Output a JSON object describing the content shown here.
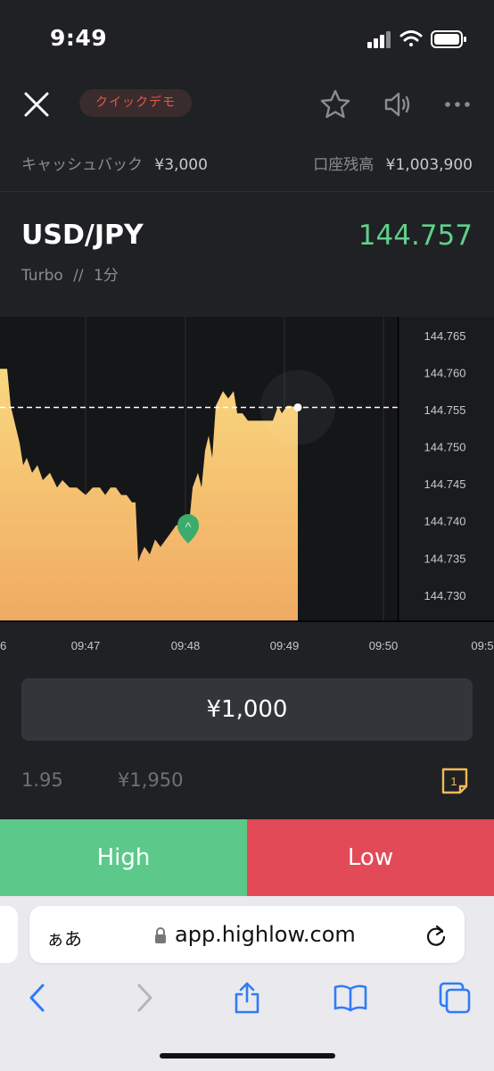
{
  "status_bar": {
    "time": "9:49"
  },
  "header": {
    "mode_badge": "クイックデモ",
    "cashback_label": "キャッシュバック",
    "cashback_value": "¥3,000",
    "balance_label": "口座残高",
    "balance_value": "¥1,003,900"
  },
  "instrument": {
    "pair": "USD/JPY",
    "price": "144.757",
    "type": "Turbo",
    "separator": "//",
    "duration": "1分"
  },
  "chart_data": {
    "type": "area",
    "y_ticks": [
      "144.765",
      "144.760",
      "144.755",
      "144.750",
      "144.745",
      "144.740",
      "144.735",
      "144.730"
    ],
    "x_ticks": [
      "6",
      "09:47",
      "09:48",
      "09:49",
      "09:50",
      "09:5"
    ],
    "current_level": 144.7553,
    "ylim": [
      144.7265,
      144.7675
    ],
    "series": [
      {
        "x": [
          0,
          8,
          12,
          22,
          26,
          30,
          36,
          42,
          48,
          56,
          64,
          70,
          78,
          86,
          96,
          104,
          112,
          118,
          124,
          130,
          136,
          142,
          148,
          152,
          155,
          158,
          162,
          168,
          174,
          180,
          186,
          192,
          198,
          204,
          208,
          212,
          216,
          222,
          226,
          230,
          234,
          238,
          242,
          246,
          250,
          256,
          262,
          266,
          272,
          278,
          284,
          290,
          296,
          302,
          306,
          312,
          316,
          322,
          326,
          332,
          334
        ],
        "y": [
          144.7605,
          144.7605,
          144.7555,
          144.7505,
          144.7475,
          144.7485,
          144.7465,
          144.7475,
          144.7455,
          144.7465,
          144.7445,
          144.7455,
          144.7445,
          144.7445,
          144.7435,
          144.7445,
          144.7445,
          144.7435,
          144.7445,
          144.7445,
          144.7435,
          144.7435,
          144.7425,
          144.7425,
          144.7345,
          144.7355,
          144.7365,
          144.7355,
          144.7375,
          144.7365,
          144.7375,
          144.7385,
          144.7395,
          144.7385,
          144.7375,
          144.7395,
          144.7445,
          144.7465,
          144.7445,
          144.7495,
          144.7515,
          144.7485,
          144.7555,
          144.7565,
          144.7575,
          144.7565,
          144.7575,
          144.7545,
          144.7545,
          144.7535,
          144.7535,
          144.7535,
          144.7535,
          144.7535,
          144.7535,
          144.7555,
          144.7545,
          144.7555,
          144.7555,
          144.7553,
          144.7553
        ]
      }
    ],
    "marker": {
      "x": 211,
      "y": 144.739,
      "label": "^"
    },
    "colors": {
      "area_top": "#f9d77e",
      "area_bottom": "#f0aa63",
      "level_line": "#ffffff",
      "marker": "#3dab6b"
    },
    "grid": true
  },
  "trade": {
    "amount": "¥1,000",
    "payout_rate": "1.95",
    "payout_amount": "¥1,950",
    "count_icon_value": "1",
    "high_label": "High",
    "low_label": "Low"
  },
  "browser": {
    "aa_label": "ぁあ",
    "url": "app.highlow.com"
  },
  "icons": {
    "close": "close-icon",
    "star": "star-icon",
    "sound": "speaker-icon",
    "more": "more-icon",
    "back": "chevron-left-icon",
    "forward": "chevron-right-icon",
    "share": "share-icon",
    "bookmarks": "book-icon",
    "tabs": "tabs-icon"
  }
}
